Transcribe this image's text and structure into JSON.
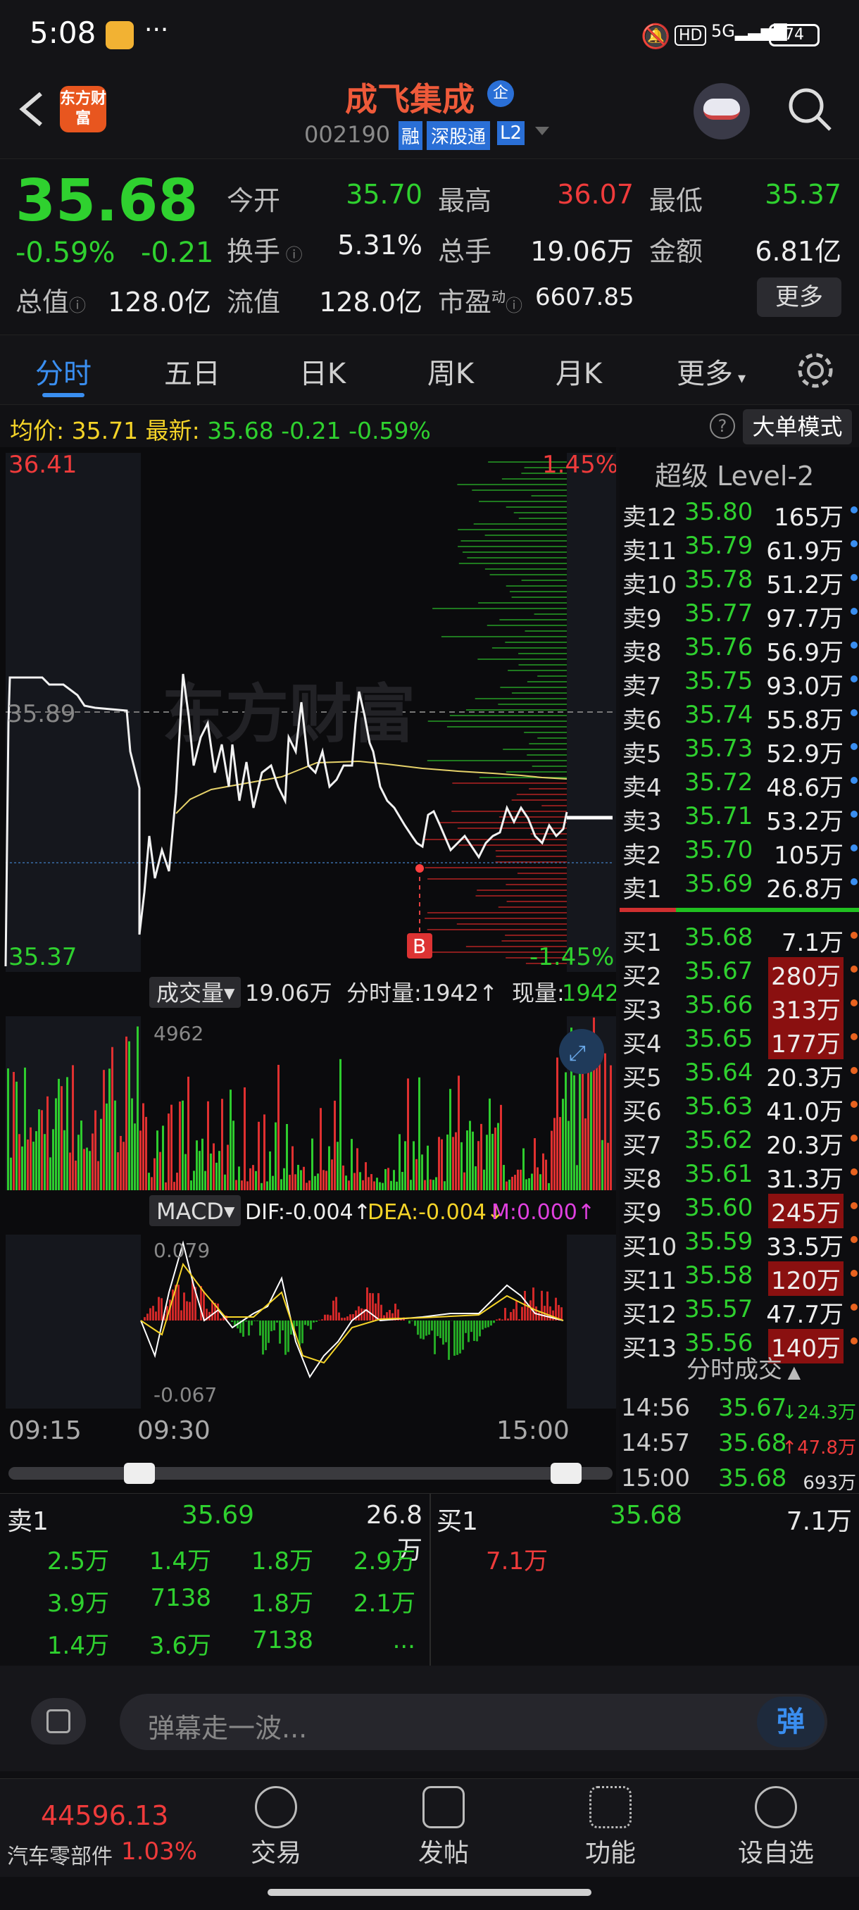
{
  "status": {
    "time": "5:08",
    "battery": "74",
    "net": "5G",
    "hd": "HD"
  },
  "header": {
    "back_icon": "chevron-left-icon",
    "logo_text": "东方财富",
    "name": "成飞集成",
    "badge": "企",
    "code": "002190",
    "tag1": "融",
    "tag2": "深股通",
    "tag3": "L2"
  },
  "quote": {
    "price": "35.68",
    "pct": "-0.59%",
    "chg": "-0.21",
    "open_label": "今开",
    "open": "35.70",
    "high_label": "最高",
    "high": "36.07",
    "low_label": "最低",
    "low": "35.37",
    "turnover_label": "换手",
    "turnover": "5.31%",
    "vol_label": "总手",
    "vol": "19.06万",
    "amount_label": "金额",
    "amount": "6.81亿",
    "mktcap_label": "总值",
    "mktcap": "128.0亿",
    "float_label": "流值",
    "float": "128.0亿",
    "pe_label": "市盈",
    "pe_sup": "动",
    "pe": "6607.85",
    "more": "更多"
  },
  "tabs": [
    "分时",
    "五日",
    "日K",
    "周K",
    "月K",
    "更多"
  ],
  "info": {
    "avg_label": "均价:",
    "avg": "35.71",
    "latest_label": "最新:",
    "latest": "35.68",
    "chg": "-0.21",
    "pct": "-0.59%",
    "mode": "大单模式"
  },
  "chart": {
    "y_high": "36.41",
    "y_pct_high": "1.45%",
    "y_mid": "35.89",
    "y_low": "35.37",
    "y_pct_low": "-1.45%",
    "watermark": "东方财富",
    "marker": "B",
    "vol_label": "成交量",
    "vol_total": "19.06万",
    "vol_tick_label": "分时量:1942↑",
    "vol_now_label": "现量:",
    "vol_now": "1942",
    "vol_max": "4962",
    "macd_label": "MACD",
    "dif": "DIF:-0.004↑",
    "dea": "DEA:-0.004↓",
    "m": "M:0.000↑",
    "macd_hi": "0.079",
    "macd_lo": "-0.067",
    "t1": "09:15",
    "t2": "09:30",
    "t3": "15:00"
  },
  "level2": {
    "title": "超级 Level-2",
    "asks": [
      [
        "卖12",
        "35.80",
        "165万"
      ],
      [
        "卖11",
        "35.79",
        "61.9万"
      ],
      [
        "卖10",
        "35.78",
        "51.2万"
      ],
      [
        "卖9",
        "35.77",
        "97.7万"
      ],
      [
        "卖8",
        "35.76",
        "56.9万"
      ],
      [
        "卖7",
        "35.75",
        "93.0万"
      ],
      [
        "卖6",
        "35.74",
        "55.8万"
      ],
      [
        "卖5",
        "35.73",
        "52.9万"
      ],
      [
        "卖4",
        "35.72",
        "48.6万"
      ],
      [
        "卖3",
        "35.71",
        "53.2万"
      ],
      [
        "卖2",
        "35.70",
        "105万"
      ],
      [
        "卖1",
        "35.69",
        "26.8万"
      ]
    ],
    "bids": [
      [
        "买1",
        "35.68",
        "7.1万"
      ],
      [
        "买2",
        "35.67",
        "280万"
      ],
      [
        "买3",
        "35.66",
        "313万"
      ],
      [
        "买4",
        "35.65",
        "177万"
      ],
      [
        "买5",
        "35.64",
        "20.3万"
      ],
      [
        "买6",
        "35.63",
        "41.0万"
      ],
      [
        "买7",
        "35.62",
        "20.3万"
      ],
      [
        "买8",
        "35.61",
        "31.3万"
      ],
      [
        "买9",
        "35.60",
        "245万"
      ],
      [
        "买10",
        "35.59",
        "33.5万"
      ],
      [
        "买11",
        "35.58",
        "120万"
      ],
      [
        "买12",
        "35.57",
        "47.7万"
      ],
      [
        "买13",
        "35.56",
        "140万"
      ]
    ],
    "trades_title": "分时成交",
    "trades": [
      [
        "14:56",
        "35.67",
        "↓",
        "24.3万"
      ],
      [
        "14:57",
        "35.68",
        "↑",
        "47.8万"
      ],
      [
        "15:00",
        "35.68",
        "",
        "693万"
      ]
    ]
  },
  "detail": {
    "sell_label": "卖1",
    "sell_price": "35.69",
    "sell_vol": "26.8万",
    "buy_label": "买1",
    "buy_price": "35.68",
    "buy_vol": "7.1万",
    "sell_orders": [
      "2.5万",
      "1.4万",
      "1.8万",
      "2.9万",
      "3.9万",
      "7138",
      "1.8万",
      "2.1万",
      "1.4万",
      "3.6万",
      "7138",
      "..."
    ],
    "buy_orders": [
      "7.1万"
    ]
  },
  "danmu": {
    "placeholder": "弹幕走一波...",
    "send": "弹"
  },
  "nav": {
    "index_value": "44596.13",
    "index_name": "汽车零部件",
    "index_pct": "1.03%",
    "items": [
      "交易",
      "发帖",
      "功能",
      "设自选"
    ]
  }
}
